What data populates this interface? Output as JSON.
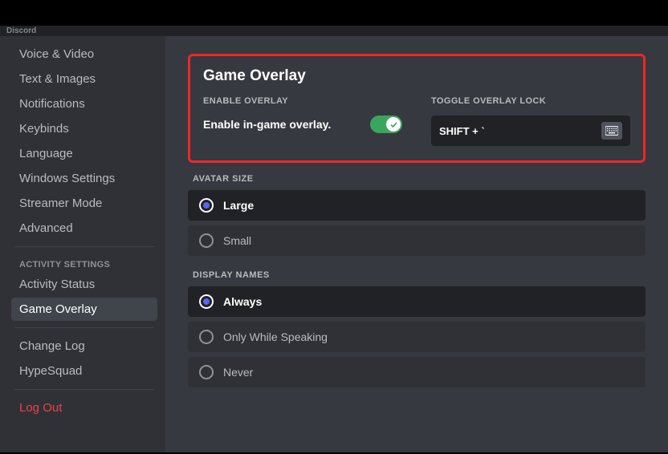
{
  "titlebar": {
    "app_name": "Discord"
  },
  "sidebar": {
    "items_top": [
      {
        "label": "Voice & Video"
      },
      {
        "label": "Text & Images"
      },
      {
        "label": "Notifications"
      },
      {
        "label": "Keybinds"
      },
      {
        "label": "Language"
      },
      {
        "label": "Windows Settings"
      },
      {
        "label": "Streamer Mode"
      },
      {
        "label": "Advanced"
      }
    ],
    "activity_header": "ACTIVITY SETTINGS",
    "activity_items": [
      {
        "label": "Activity Status"
      },
      {
        "label": "Game Overlay"
      }
    ],
    "misc_items": [
      {
        "label": "Change Log"
      },
      {
        "label": "HypeSquad"
      }
    ],
    "logout_label": "Log Out"
  },
  "overlay": {
    "title": "Game Overlay",
    "enable_header": "ENABLE OVERLAY",
    "enable_text": "Enable in-game overlay.",
    "toggle_on": true,
    "lock_header": "TOGGLE OVERLAY LOCK",
    "keybind": "SHIFT + `"
  },
  "avatar_size": {
    "header": "AVATAR SIZE",
    "options": [
      {
        "label": "Large",
        "selected": true
      },
      {
        "label": "Small",
        "selected": false
      }
    ]
  },
  "display_names": {
    "header": "DISPLAY NAMES",
    "options": [
      {
        "label": "Always",
        "selected": true
      },
      {
        "label": "Only While Speaking",
        "selected": false
      },
      {
        "label": "Never",
        "selected": false
      }
    ]
  }
}
